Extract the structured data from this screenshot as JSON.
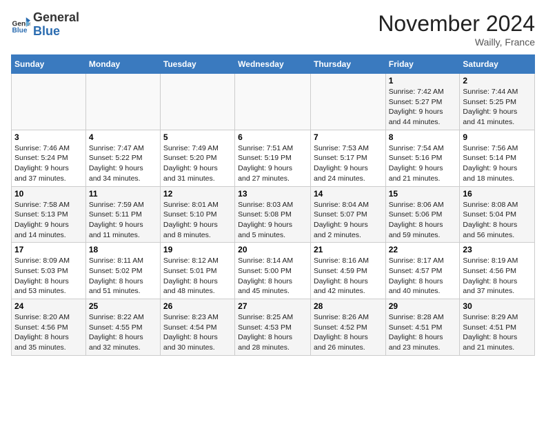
{
  "header": {
    "logo_general": "General",
    "logo_blue": "Blue",
    "month_title": "November 2024",
    "location": "Wailly, France"
  },
  "weekdays": [
    "Sunday",
    "Monday",
    "Tuesday",
    "Wednesday",
    "Thursday",
    "Friday",
    "Saturday"
  ],
  "weeks": [
    [
      {
        "day": "",
        "info": ""
      },
      {
        "day": "",
        "info": ""
      },
      {
        "day": "",
        "info": ""
      },
      {
        "day": "",
        "info": ""
      },
      {
        "day": "",
        "info": ""
      },
      {
        "day": "1",
        "info": "Sunrise: 7:42 AM\nSunset: 5:27 PM\nDaylight: 9 hours\nand 44 minutes."
      },
      {
        "day": "2",
        "info": "Sunrise: 7:44 AM\nSunset: 5:25 PM\nDaylight: 9 hours\nand 41 minutes."
      }
    ],
    [
      {
        "day": "3",
        "info": "Sunrise: 7:46 AM\nSunset: 5:24 PM\nDaylight: 9 hours\nand 37 minutes."
      },
      {
        "day": "4",
        "info": "Sunrise: 7:47 AM\nSunset: 5:22 PM\nDaylight: 9 hours\nand 34 minutes."
      },
      {
        "day": "5",
        "info": "Sunrise: 7:49 AM\nSunset: 5:20 PM\nDaylight: 9 hours\nand 31 minutes."
      },
      {
        "day": "6",
        "info": "Sunrise: 7:51 AM\nSunset: 5:19 PM\nDaylight: 9 hours\nand 27 minutes."
      },
      {
        "day": "7",
        "info": "Sunrise: 7:53 AM\nSunset: 5:17 PM\nDaylight: 9 hours\nand 24 minutes."
      },
      {
        "day": "8",
        "info": "Sunrise: 7:54 AM\nSunset: 5:16 PM\nDaylight: 9 hours\nand 21 minutes."
      },
      {
        "day": "9",
        "info": "Sunrise: 7:56 AM\nSunset: 5:14 PM\nDaylight: 9 hours\nand 18 minutes."
      }
    ],
    [
      {
        "day": "10",
        "info": "Sunrise: 7:58 AM\nSunset: 5:13 PM\nDaylight: 9 hours\nand 14 minutes."
      },
      {
        "day": "11",
        "info": "Sunrise: 7:59 AM\nSunset: 5:11 PM\nDaylight: 9 hours\nand 11 minutes."
      },
      {
        "day": "12",
        "info": "Sunrise: 8:01 AM\nSunset: 5:10 PM\nDaylight: 9 hours\nand 8 minutes."
      },
      {
        "day": "13",
        "info": "Sunrise: 8:03 AM\nSunset: 5:08 PM\nDaylight: 9 hours\nand 5 minutes."
      },
      {
        "day": "14",
        "info": "Sunrise: 8:04 AM\nSunset: 5:07 PM\nDaylight: 9 hours\nand 2 minutes."
      },
      {
        "day": "15",
        "info": "Sunrise: 8:06 AM\nSunset: 5:06 PM\nDaylight: 8 hours\nand 59 minutes."
      },
      {
        "day": "16",
        "info": "Sunrise: 8:08 AM\nSunset: 5:04 PM\nDaylight: 8 hours\nand 56 minutes."
      }
    ],
    [
      {
        "day": "17",
        "info": "Sunrise: 8:09 AM\nSunset: 5:03 PM\nDaylight: 8 hours\nand 53 minutes."
      },
      {
        "day": "18",
        "info": "Sunrise: 8:11 AM\nSunset: 5:02 PM\nDaylight: 8 hours\nand 51 minutes."
      },
      {
        "day": "19",
        "info": "Sunrise: 8:12 AM\nSunset: 5:01 PM\nDaylight: 8 hours\nand 48 minutes."
      },
      {
        "day": "20",
        "info": "Sunrise: 8:14 AM\nSunset: 5:00 PM\nDaylight: 8 hours\nand 45 minutes."
      },
      {
        "day": "21",
        "info": "Sunrise: 8:16 AM\nSunset: 4:59 PM\nDaylight: 8 hours\nand 42 minutes."
      },
      {
        "day": "22",
        "info": "Sunrise: 8:17 AM\nSunset: 4:57 PM\nDaylight: 8 hours\nand 40 minutes."
      },
      {
        "day": "23",
        "info": "Sunrise: 8:19 AM\nSunset: 4:56 PM\nDaylight: 8 hours\nand 37 minutes."
      }
    ],
    [
      {
        "day": "24",
        "info": "Sunrise: 8:20 AM\nSunset: 4:56 PM\nDaylight: 8 hours\nand 35 minutes."
      },
      {
        "day": "25",
        "info": "Sunrise: 8:22 AM\nSunset: 4:55 PM\nDaylight: 8 hours\nand 32 minutes."
      },
      {
        "day": "26",
        "info": "Sunrise: 8:23 AM\nSunset: 4:54 PM\nDaylight: 8 hours\nand 30 minutes."
      },
      {
        "day": "27",
        "info": "Sunrise: 8:25 AM\nSunset: 4:53 PM\nDaylight: 8 hours\nand 28 minutes."
      },
      {
        "day": "28",
        "info": "Sunrise: 8:26 AM\nSunset: 4:52 PM\nDaylight: 8 hours\nand 26 minutes."
      },
      {
        "day": "29",
        "info": "Sunrise: 8:28 AM\nSunset: 4:51 PM\nDaylight: 8 hours\nand 23 minutes."
      },
      {
        "day": "30",
        "info": "Sunrise: 8:29 AM\nSunset: 4:51 PM\nDaylight: 8 hours\nand 21 minutes."
      }
    ]
  ]
}
